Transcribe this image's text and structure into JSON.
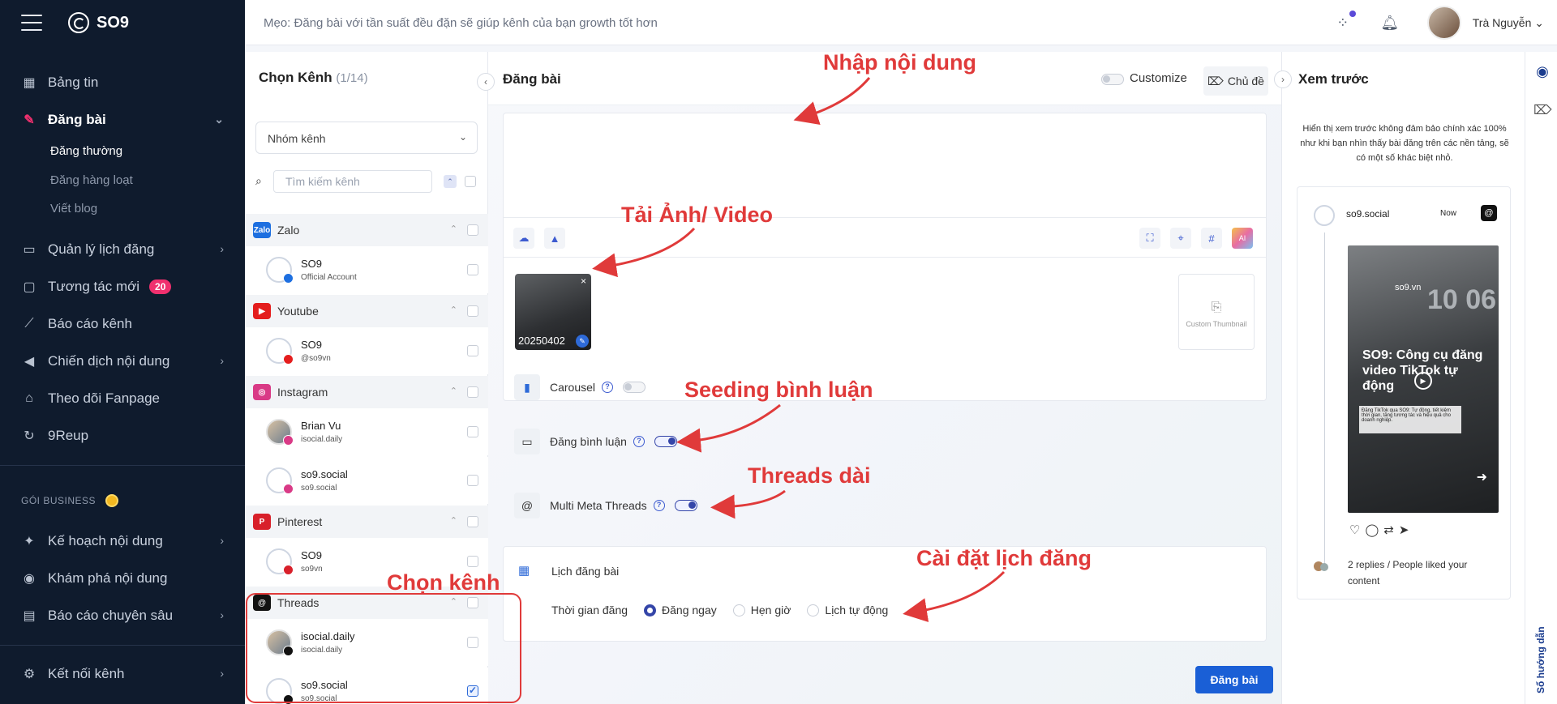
{
  "app": {
    "name": "SO9"
  },
  "topbar": {
    "tip": "Mẹo: Đăng bài với tần suất đều đặn sẽ giúp kênh của bạn growth tốt hơn",
    "user_name": "Trà Nguyễn"
  },
  "sidebar": {
    "items": [
      {
        "label": "Bảng tin",
        "icon": "dashboard-icon"
      },
      {
        "label": "Đăng bài",
        "icon": "edit-icon"
      },
      {
        "label": "Quản lý lịch đăng",
        "icon": "calendar-icon"
      },
      {
        "label": "Tương tác mới",
        "icon": "chat-icon",
        "badge": "20"
      },
      {
        "label": "Báo cáo kênh",
        "icon": "chart-icon"
      },
      {
        "label": "Chiến dịch nội dung",
        "icon": "megaphone-icon"
      },
      {
        "label": "Theo dõi Fanpage",
        "icon": "store-icon"
      },
      {
        "label": "9Reup",
        "icon": "reup-icon"
      }
    ],
    "subitems": [
      "Đăng thường",
      "Đăng hàng loạt",
      "Viết blog"
    ],
    "section_label": "GÓI BUSINESS",
    "business_items": [
      {
        "label": "Kế hoạch nội dung",
        "icon": "plan-icon"
      },
      {
        "label": "Khám phá nội dung",
        "icon": "compass-icon"
      },
      {
        "label": "Báo cáo chuyên sâu",
        "icon": "report-icon"
      }
    ],
    "bottom_item": {
      "label": "Kết nối kênh",
      "icon": "plug-icon"
    }
  },
  "channels": {
    "title": "Chọn Kênh",
    "count": "(1/14)",
    "group_select": "Nhóm kênh",
    "search_placeholder": "Tìm kiếm kênh",
    "platforms": [
      {
        "name": "Zalo",
        "color": "#1d6fe0",
        "accounts": [
          {
            "name": "SO9",
            "handle": "Official Account",
            "checked": false
          }
        ]
      },
      {
        "name": "Youtube",
        "color": "#e41d1d",
        "accounts": [
          {
            "name": "SO9",
            "handle": "@so9vn",
            "checked": false
          }
        ]
      },
      {
        "name": "Instagram",
        "color": "#d93a86",
        "accounts": [
          {
            "name": "Brian Vu",
            "handle": "isocial.daily",
            "checked": false
          },
          {
            "name": "so9.social",
            "handle": "so9.social",
            "checked": false
          }
        ]
      },
      {
        "name": "Pinterest",
        "color": "#d8202a",
        "accounts": [
          {
            "name": "SO9",
            "handle": "so9vn",
            "checked": false
          }
        ]
      },
      {
        "name": "Threads",
        "color": "#111111",
        "accounts": [
          {
            "name": "isocial.daily",
            "handle": "isocial.daily",
            "checked": false
          },
          {
            "name": "so9.social",
            "handle": "so9.social",
            "checked": true
          }
        ]
      }
    ]
  },
  "compose": {
    "title": "Đăng bài",
    "customize_label": "Customize",
    "topic_label": "Chủ đề",
    "media_name": "20250402",
    "custom_thumbnail": "Custom Thumbnail",
    "options": [
      {
        "label": "Carousel",
        "on": false
      },
      {
        "label": "Đăng bình luận",
        "on": true
      },
      {
        "label": "Multi Meta Threads",
        "on": true
      }
    ],
    "schedule": {
      "title": "Lịch đăng bài",
      "time_label": "Thời gian đăng",
      "choices": [
        "Đăng ngay",
        "Hẹn giờ",
        "Lịch tự động"
      ],
      "selected": 0
    },
    "submit_label": "Đăng bài"
  },
  "preview": {
    "title": "Xem trước",
    "note": "Hiển thị xem trước không đảm bảo chính xác 100% như khi bạn nhìn thấy bài đăng trên các nền tảng, sẽ có một số khác biệt nhỏ.",
    "account": "so9.social",
    "time": "Now",
    "image_headline": "SO9: Công cụ đăng video TikTok tự động",
    "image_brand": "so9.vn",
    "image_clock": "10 06",
    "image_caption": "Đăng TikTok qua SO9: Tự động, tiết kiệm thời gian, tăng tương tác và hiệu quả cho doanh nghiệp.",
    "replies": "2 replies / People liked your content"
  },
  "rail": {
    "guide_label": "Sổ hướng dẫn"
  },
  "annotations": {
    "content": "Nhập nội dung",
    "media": "Tải Ảnh/ Video",
    "seeding": "Seeding bình luận",
    "threads": "Threads dài",
    "schedule": "Cài đặt lịch đăng",
    "channel": "Chọn kênh"
  },
  "colors": {
    "accent": "#1a5fd6",
    "sidebar_bg": "#0f1b2d",
    "annotation": "#e03a3a",
    "badge": "#f0306e"
  }
}
